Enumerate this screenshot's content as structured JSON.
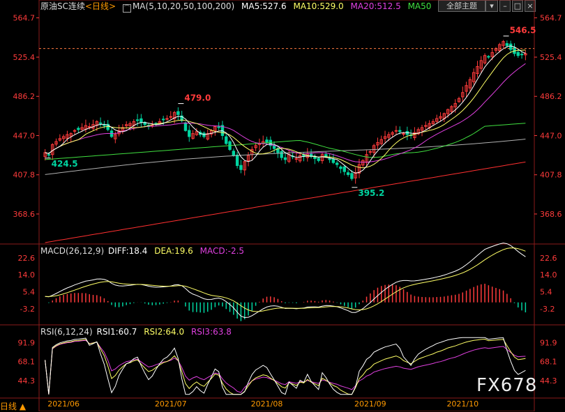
{
  "header": {
    "instrument": "原油SC连续",
    "period_tag": "<日线>",
    "ma_icon": "ma-chart-icon",
    "ma_params": "MA(5,10,20,50,100,200)",
    "ma5": "MA5:527.6",
    "ma10": "MA10:529.0",
    "ma20": "MA20:512.5",
    "ma50": "MA50",
    "selector": "全部主题"
  },
  "macd_legend": {
    "title": "MACD(26,12,9)",
    "diff": "DIFF:18.4",
    "dea": "DEA:19.6",
    "macd": "MACD:-2.5"
  },
  "rsi_legend": {
    "title": "RSI(6,12,24)",
    "rsi1": "RSI1:60.7",
    "rsi2": "RSI2:64.0",
    "rsi3": "RSI3:63.8"
  },
  "footer": {
    "period_label": "日线 ▲",
    "watermark": "FX678"
  },
  "colors": {
    "up": "#ff3b3b",
    "down": "#00d4a0",
    "ma5": "#ffffff",
    "ma10": "#ffff66",
    "ma20": "#e040e0",
    "ma50": "#40e040",
    "ma100": "#b0b0b0",
    "ma200": "#ff3030",
    "axis": "#ff3b3b",
    "date": "#ff9a00"
  },
  "chart_data": [
    {
      "type": "candlestick",
      "name": "price",
      "y_ticks": [
        "564.7",
        "525.4",
        "486.2",
        "447.0",
        "407.8",
        "368.6"
      ],
      "ylim": [
        340,
        570
      ],
      "current_price_line": 534,
      "annotations": [
        {
          "label": "479.0",
          "index": 36,
          "kind": "high"
        },
        {
          "label": "424.5",
          "index": 0,
          "kind": "low"
        },
        {
          "label": "395.2",
          "index": 83,
          "kind": "low"
        },
        {
          "label": "546.5",
          "index": 124,
          "kind": "high"
        }
      ],
      "x_ticks": [
        {
          "label": "2021/06",
          "index": 5
        },
        {
          "label": "2021/07",
          "index": 34
        },
        {
          "label": "2021/08",
          "index": 60
        },
        {
          "label": "2021/09",
          "index": 88
        },
        {
          "label": "2021/10",
          "index": 113
        }
      ],
      "close_path": [
        430,
        428,
        438,
        441,
        444,
        446,
        448,
        449,
        452,
        453,
        455,
        457,
        456,
        458,
        461,
        459,
        457,
        453,
        446,
        448,
        452,
        455,
        458,
        459,
        461,
        462,
        460,
        458,
        456,
        457,
        459,
        461,
        463,
        464,
        466,
        470,
        468,
        462,
        452,
        446,
        449,
        451,
        448,
        446,
        449,
        452,
        456,
        455,
        447,
        439,
        433,
        427,
        417,
        413,
        421,
        427,
        433,
        437,
        439,
        441,
        440,
        437,
        434,
        430,
        425,
        423,
        428,
        426,
        424,
        427,
        426,
        429,
        426,
        424,
        422,
        428,
        426,
        423,
        420,
        418,
        414,
        411,
        408,
        404,
        410,
        418,
        422,
        428,
        431,
        437,
        440,
        443,
        446,
        448,
        450,
        452,
        451,
        449,
        448,
        447,
        450,
        453,
        455,
        457,
        459,
        461,
        464,
        466,
        469,
        473,
        476,
        479,
        484,
        490,
        497,
        503,
        510,
        516,
        522,
        527,
        526,
        530,
        534,
        538,
        541,
        537,
        533,
        529,
        527,
        528,
        529
      ],
      "moving_averages": [
        {
          "name": "MA5",
          "value": 527.6
        },
        {
          "name": "MA10",
          "value": 529.0
        },
        {
          "name": "MA20",
          "value": 512.5
        },
        {
          "name": "MA50"
        }
      ]
    },
    {
      "type": "line+bar",
      "name": "MACD",
      "y_ticks": [
        "22.6",
        "14.0",
        "5.4",
        "-3.2"
      ],
      "ylim": [
        -10,
        24
      ],
      "series": [
        {
          "name": "DIFF",
          "last": 18.4
        },
        {
          "name": "DEA",
          "last": 19.6
        },
        {
          "name": "MACD",
          "last": -2.5
        }
      ]
    },
    {
      "type": "line",
      "name": "RSI",
      "y_ticks": [
        "91.9",
        "68.1",
        "44.3"
      ],
      "ylim": [
        25,
        100
      ],
      "series": [
        {
          "name": "RSI1",
          "last": 60.7
        },
        {
          "name": "RSI2",
          "last": 64.0
        },
        {
          "name": "RSI3",
          "last": 63.8
        }
      ]
    }
  ]
}
